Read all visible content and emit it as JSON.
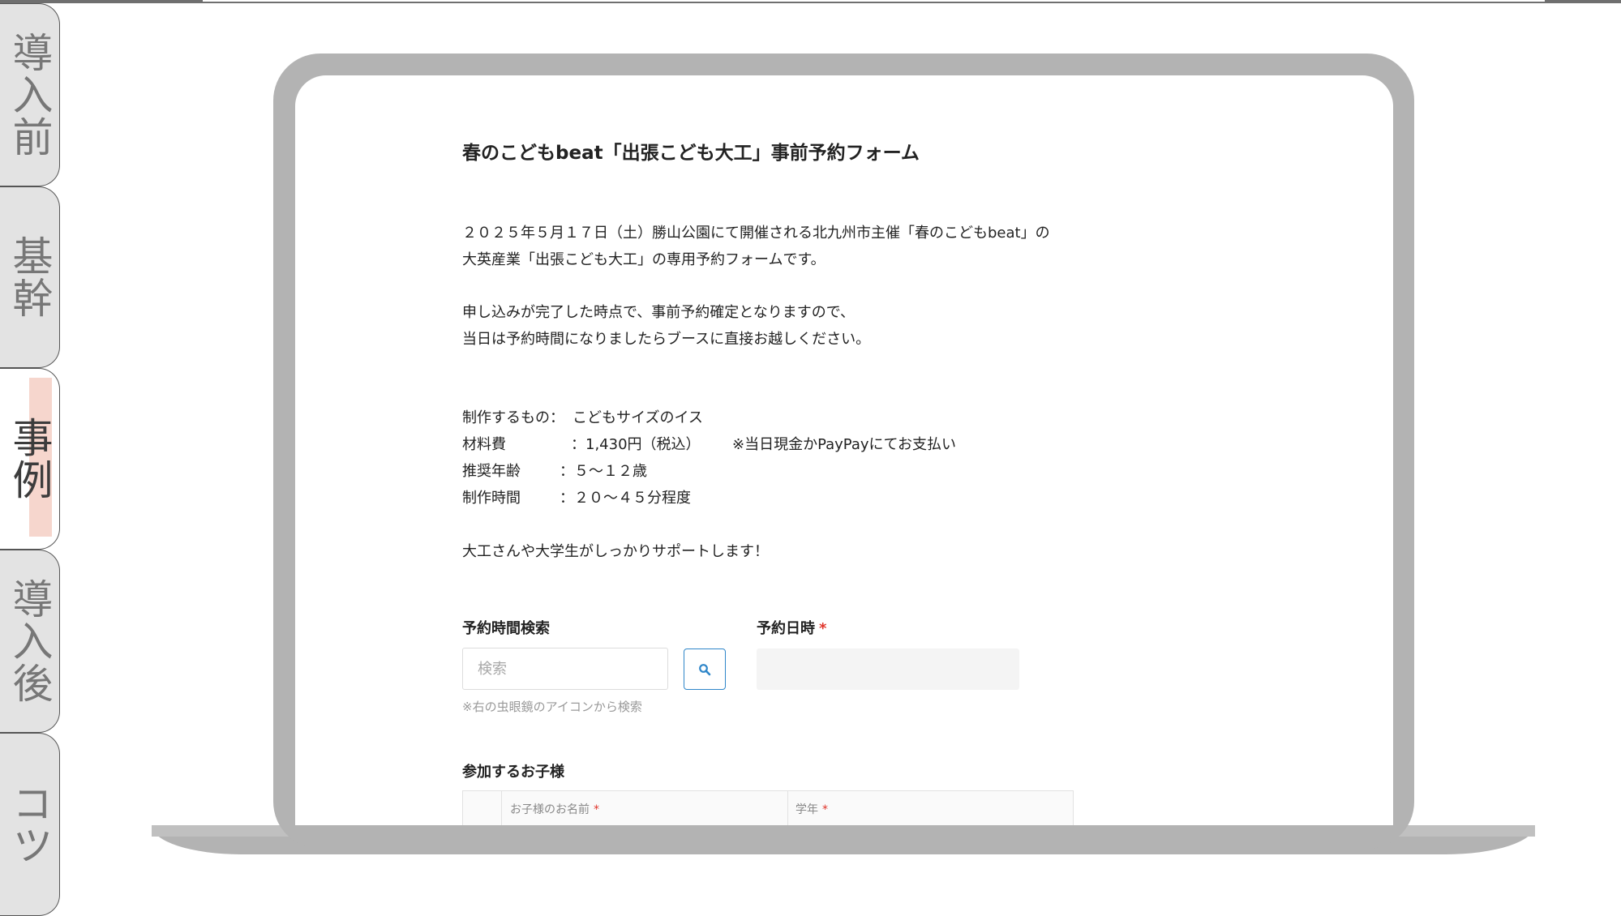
{
  "tabs": [
    {
      "label": "導入前",
      "active": false
    },
    {
      "label": "基幹",
      "active": false
    },
    {
      "label": "事例",
      "active": true
    },
    {
      "label": "導入後",
      "active": false
    },
    {
      "label": "コツ",
      "active": false
    }
  ],
  "form": {
    "title": "春のこどもbeat「出張こども大工」事前予約フォーム",
    "intro": [
      "２０２５年５月１７日（土）勝山公園にて開催される北九州市主催「春のこどもbeat」の",
      "大英産業「出張こども大工」の専用予約フォームです。"
    ],
    "notice": [
      "申し込みが完了した時点で、事前予約確定となりますので、",
      "当日は予約時間になりましたらブースに直接お越しください。"
    ],
    "specs": [
      {
        "label": "制作するもの：",
        "value": "こどもサイズのイス"
      },
      {
        "label": "材料費",
        "value": "：1,430円（税込）",
        "note": "※当日現金かPayPayにてお支払い"
      },
      {
        "label": "推奨年齢",
        "value": "：５〜１２歳"
      },
      {
        "label": "制作時間",
        "value": "：２０〜４５分程度"
      }
    ],
    "support": "大工さんや大学生がしっかりサポートします！",
    "search": {
      "label": "予約時間検索",
      "placeholder": "検索",
      "hint": "※右の虫眼鏡のアイコンから検索"
    },
    "date": {
      "label": "予約日時",
      "required_mark": "*"
    },
    "children": {
      "label": "参加するお子様",
      "col_name": "お子様のお名前",
      "col_grade": "学年",
      "required_mark": "*"
    }
  },
  "colors": {
    "accent": "#2f86c9",
    "required": "#e0352b",
    "tab_highlight": "#f6d6cd",
    "laptop": "#b3b3b3"
  }
}
